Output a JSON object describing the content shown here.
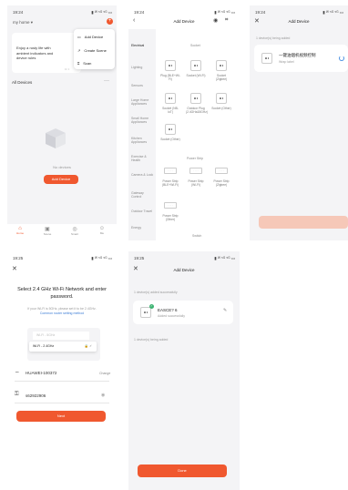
{
  "p1": {
    "time": "19:24",
    "signal": "▮ ᵂ ⁵ᴳ ⁵ᴳ ▭",
    "home_name": "my home ▾",
    "welcome": "Enjoy a rusty life with ambient indicators and device rules",
    "menu": [
      "Add Device",
      "Create Scene",
      "Scan"
    ],
    "all_devices": "All Devices",
    "no_devices": "No devices",
    "add_device_btn": "Add Device",
    "tabs": [
      "Home",
      "Scene",
      "Smart",
      "Me"
    ]
  },
  "p2": {
    "time": "19:24",
    "signal": "▮ ᵂ ⁵ᴳ ⁵ᴳ ▭",
    "title": "Add Device",
    "categories": [
      "Electrical",
      "Lighting",
      "Sensors",
      "Large Home Appliances",
      "Small Home Appliances",
      "Kitchen Appliances",
      "Exercise & Health",
      "Camera & Lock",
      "Gateway Control",
      "Outdoor Travel",
      "Energy"
    ],
    "section_socket": "Socket",
    "section_powerstrip": "Power Strip",
    "section_switch": "Switch",
    "devices": [
      {
        "name": "Plug (BLE+Wi-Fi)"
      },
      {
        "name": "Socket (Wi-Fi)"
      },
      {
        "name": "Socket (Zigbee)"
      },
      {
        "name": "Socket (NB-IoT)"
      },
      {
        "name": "Outdoor Plug (2.4GHz&5GHz)"
      },
      {
        "name": "Socket (Other)"
      },
      {
        "name": "Socket (Other)"
      },
      {
        "name": "Power Strip (BLE+Wi-Fi)"
      },
      {
        "name": "Power Strip (Wi-Fi)"
      },
      {
        "name": "Power Strip (Zigbee)"
      },
      {
        "name": "Power Strip (Other)"
      }
    ]
  },
  "p3": {
    "time": "19:24",
    "signal": "▮ ᵂ ⁵ᴳ ⁵ᴳ ▭",
    "title": "Add Device",
    "hint": "1 device(s) being added",
    "item_name": "一键油烟机视频控制",
    "item_sub": "Wrap label"
  },
  "p4": {
    "time": "19:25",
    "signal": "▮ ᵂ ⁵ᴳ ⁵ᴳ ▭",
    "title": "Select 2.4 GHz Wi-Fi Network and enter password.",
    "desc": "If your Wi-Fi is 5GHz, please set it to be 2.4GHz.",
    "desc_link": "Common router setting method",
    "wifi_5g": "Wi-Fi - 5GHz",
    "wifi_24": "Wi-Fi - 2.4GHz",
    "ssid": "HUAWEI-100372",
    "change": "Change",
    "password": "s62922906",
    "next": "Next"
  },
  "p5": {
    "time": "19:25",
    "signal": "▮ ᵂ ⁵ᴳ ⁵ᴳ ▭",
    "title": "Add Device",
    "added_hint": "1 device(s) added successfully",
    "device_name": "EASCE? 6",
    "device_sub": "Added successfully",
    "adding_hint": "1 device(s) being added",
    "done": "Done"
  }
}
